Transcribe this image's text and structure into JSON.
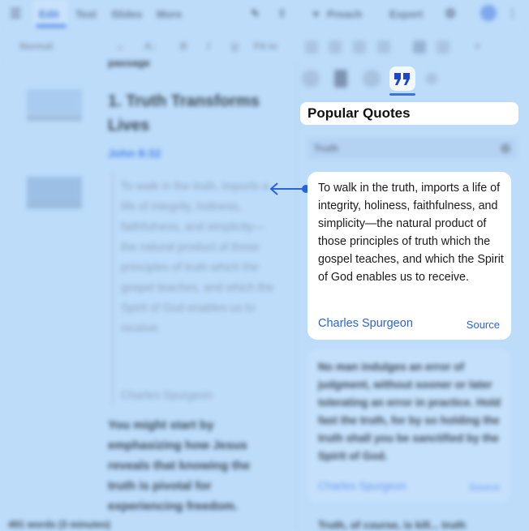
{
  "menubar": {
    "tabs": [
      "Edit",
      "Text",
      "Slides",
      "More"
    ],
    "active_tab": "Edit",
    "preach_label": "Preach",
    "export_label": "Export"
  },
  "toolbar": {
    "style_select": "Normal",
    "font_size": "Fit in"
  },
  "document": {
    "passage_label": "passage",
    "heading": "1. Truth Transforms Lives",
    "scripture_ref": "John 8:32",
    "blockquote": "To walk in the truth, imports a life of integrity, holiness, faithfulness, and simplicity—the natural product of those principles of truth which the gospel teaches, and which the Spirit of God enables us to receive.",
    "blockquote_author": "Charles Spurgeon",
    "paragraph": "You might start by emphasizing how Jesus reveals that knowing the truth is pivotal for experiencing freedom."
  },
  "footer": {
    "word_count": "491 words (3 minutes)"
  },
  "panel": {
    "title": "Popular Quotes",
    "search_value": "Truth",
    "quotes": [
      {
        "text": "To walk in the truth, imports a life of integrity, holiness, faithfulness, and simplicity—the natural product of those principles of truth which the gospel teaches, and which the Spirit of God enables us to receive.",
        "author": "Charles Spurgeon",
        "source_label": "Source"
      },
      {
        "text": "No man indulges an error of judgment, without sooner or later tolerating an error in practice. Hold fast the truth, for by so holding the truth shall you be sanctified by the Spirit of God.",
        "author": "Charles Spurgeon",
        "source_label": "Source"
      },
      {
        "text": "Truth, of course, is kill... truth",
        "author": "",
        "source_label": ""
      }
    ]
  },
  "colors": {
    "accent": "#2a63d9",
    "overlay": "#bcdcfa"
  }
}
